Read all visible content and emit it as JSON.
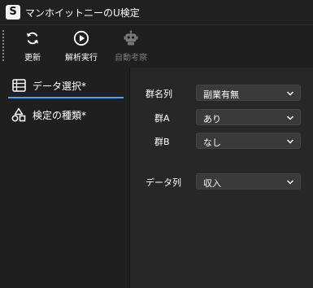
{
  "window": {
    "app_icon_letter": "S",
    "title": "マンホイットニーのU検定"
  },
  "toolbar": {
    "refresh_label": "更新",
    "run_label": "解析実行",
    "auto_label": "自動考察"
  },
  "sidebar": {
    "items": [
      {
        "label": "データ選択*",
        "icon": "table-icon",
        "active": true
      },
      {
        "label": "検定の種類*",
        "icon": "shapes-icon",
        "active": false
      }
    ]
  },
  "form": {
    "group_column": {
      "label": "群名列",
      "value": "副業有無"
    },
    "group_a": {
      "label": "群A",
      "value": "あり"
    },
    "group_b": {
      "label": "群B",
      "value": "なし"
    },
    "data_column": {
      "label": "データ列",
      "value": "収入"
    }
  },
  "colors": {
    "accent": "#4aa3ff",
    "background": "#202020",
    "panel": "#272727",
    "select_bg": "#3a3a3a"
  }
}
